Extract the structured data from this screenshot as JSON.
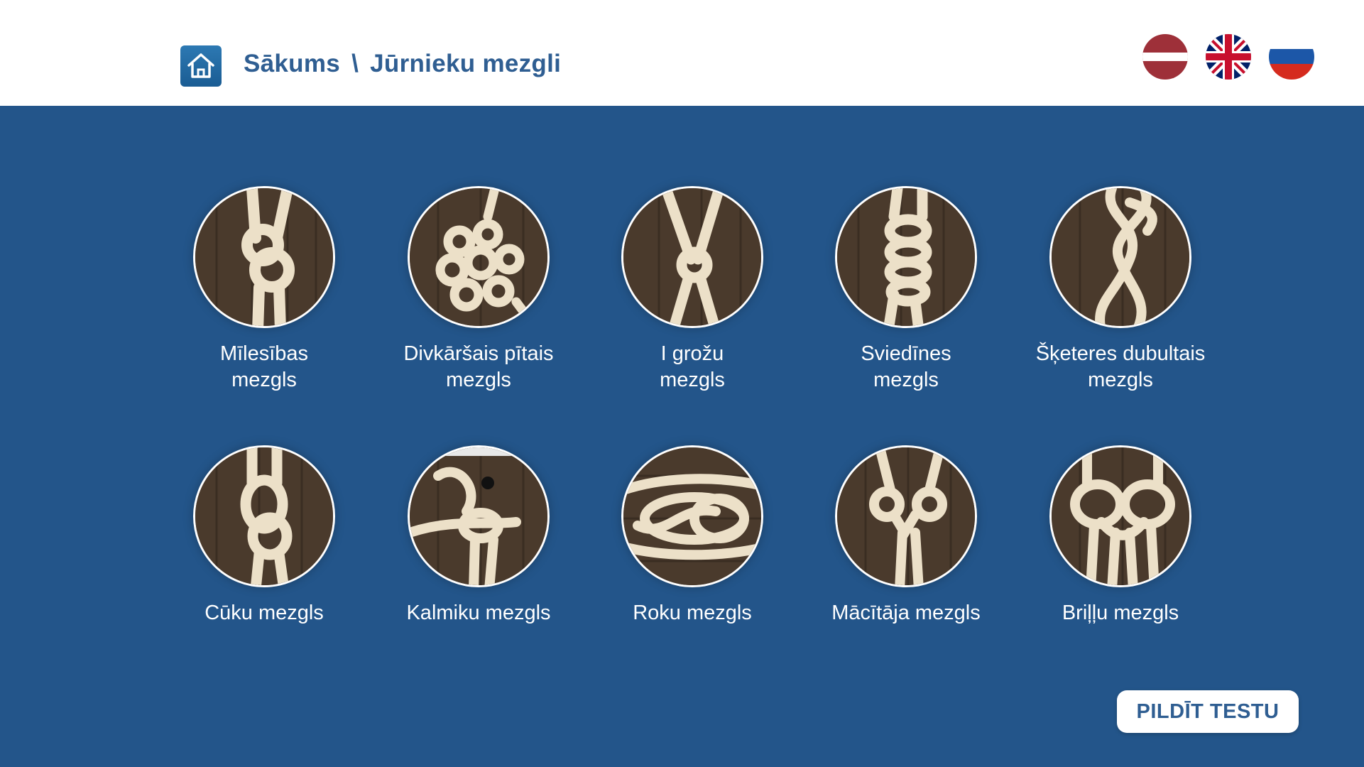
{
  "header": {
    "home_icon": "home-icon",
    "breadcrumb": {
      "home": "Sākums",
      "separator": "\\",
      "current": "Jūrnieku mezgli"
    },
    "languages": [
      {
        "code": "lv",
        "icon": "latvia-flag-icon"
      },
      {
        "code": "en",
        "icon": "uk-flag-icon"
      },
      {
        "code": "ru",
        "icon": "russia-flag-icon"
      }
    ]
  },
  "knots": [
    {
      "line1": "Mīlesības",
      "line2": "mezgls"
    },
    {
      "line1": "Divkāršais pītais",
      "line2": "mezgls"
    },
    {
      "line1": "I grožu",
      "line2": "mezgls"
    },
    {
      "line1": "Sviedīnes",
      "line2": "mezgls"
    },
    {
      "line1": "Šķeteres dubultais",
      "line2": "mezgls"
    },
    {
      "line1": "Cūku mezgls",
      "line2": ""
    },
    {
      "line1": "Kalmiku mezgls",
      "line2": ""
    },
    {
      "line1": "Roku mezgls",
      "line2": ""
    },
    {
      "line1": "Mācītāja mezgls",
      "line2": ""
    },
    {
      "line1": "Briļļu mezgls",
      "line2": ""
    }
  ],
  "actions": {
    "test_label": "PILDĪT TESTU"
  },
  "colors": {
    "background": "#23558a",
    "header_bg": "#ffffff",
    "accent_text": "#2f5e92",
    "rope": "#ece0c8",
    "wood": "#4a3a2c"
  }
}
